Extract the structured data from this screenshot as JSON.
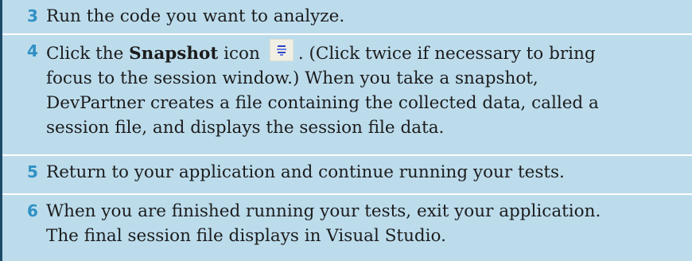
{
  "steps": [
    {
      "number": "3",
      "lines": [
        "Run the code you want to analyze."
      ]
    },
    {
      "number": "4",
      "line1_before": "Click the ",
      "line1_bold": "Snapshot",
      "line1_middle": " icon",
      "line1_after": ". (Click twice if necessary to bring",
      "lines": [
        "focus to the session window.) When you take a snapshot,",
        "DevPartner creates a file containing the collected data, called a",
        "session file, and displays the session file data."
      ],
      "icon": "snapshot-icon"
    },
    {
      "number": "5",
      "lines": [
        "Return to your application and continue running your tests."
      ]
    },
    {
      "number": "6",
      "lines": [
        "When you are finished running your tests, exit your application.",
        "The final session file displays in Visual Studio."
      ]
    }
  ],
  "colors": {
    "background": "#bcdcec",
    "step_number": "#2f90c4",
    "left_border": "#1e4a6a",
    "divider": "#ffffff"
  }
}
